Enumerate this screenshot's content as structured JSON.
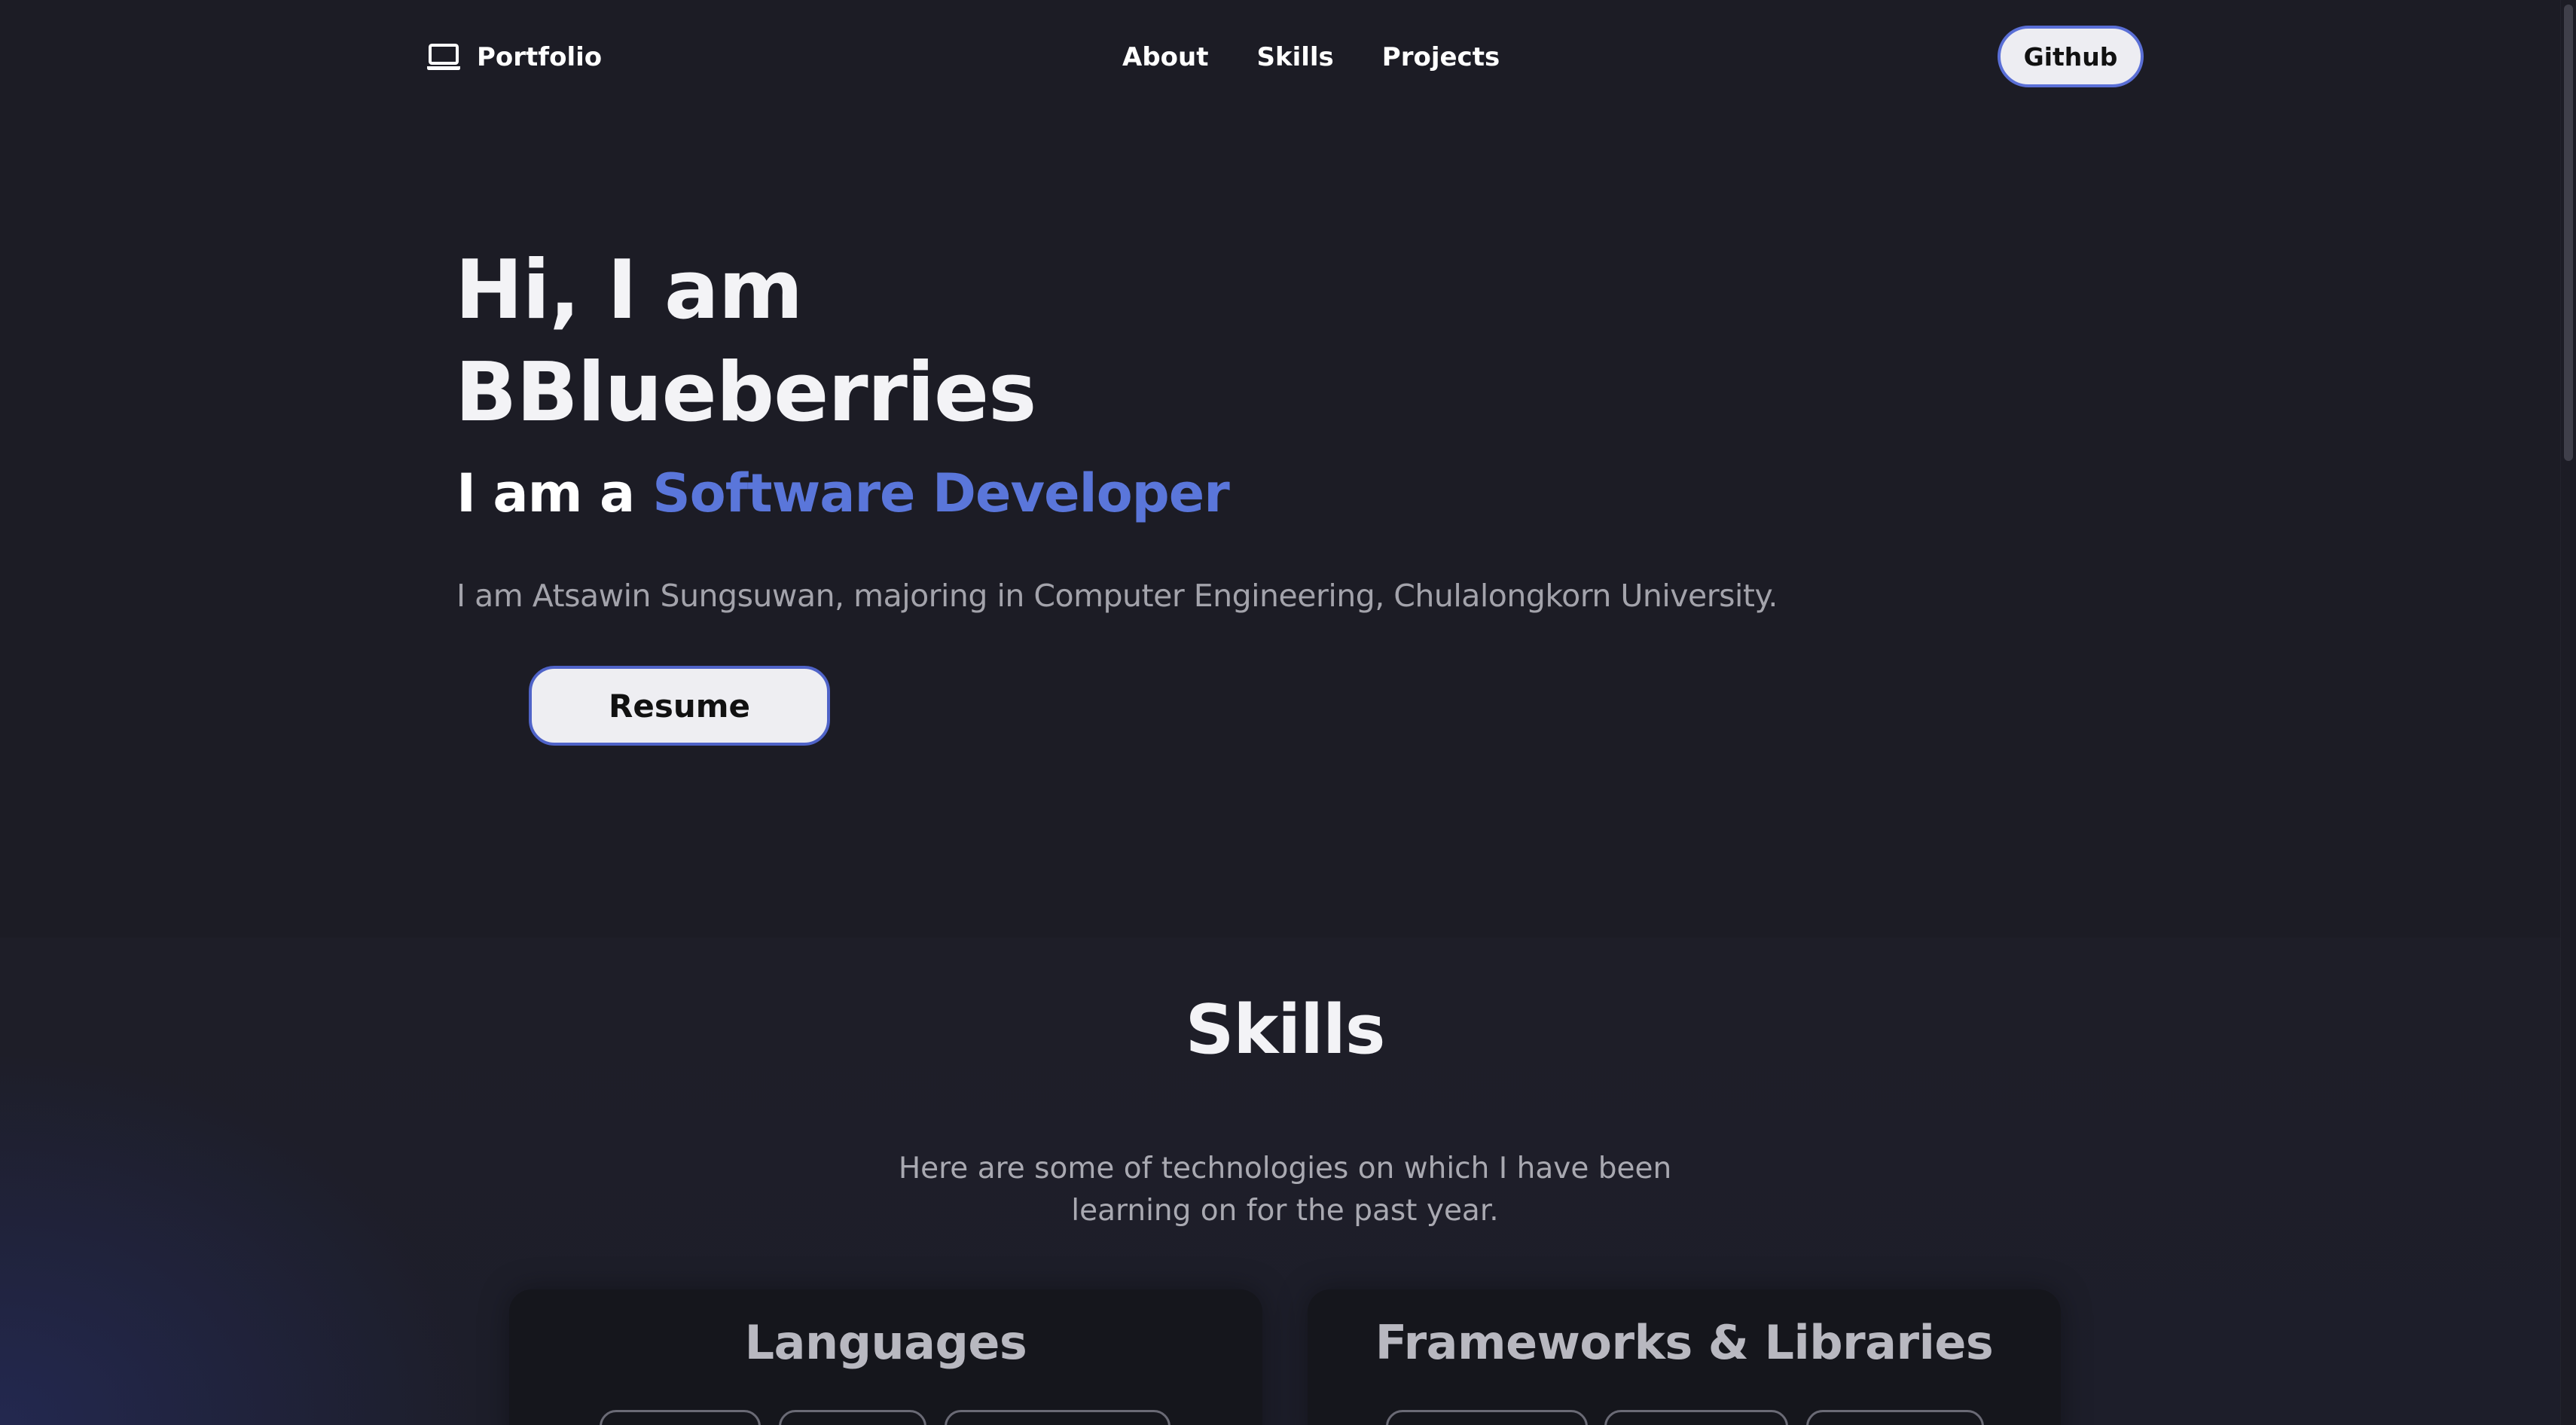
{
  "nav": {
    "brand": "Portfolio",
    "brand_icon": "laptop-icon",
    "links": [
      {
        "label": "About"
      },
      {
        "label": "Skills"
      },
      {
        "label": "Projects"
      }
    ],
    "github_label": "Github"
  },
  "hero": {
    "title_line1": "Hi, I am",
    "title_line2": "BBlueberries",
    "role_prefix": "I am a",
    "role": "Software Developer",
    "description": "I am Atsawin Sungsuwan, majoring in Computer Engineering, Chulalongkorn University.",
    "resume_label": "Resume"
  },
  "skills": {
    "title": "Skills",
    "description": "Here are some of technologies on which I have been learning on for the past year.",
    "cards": [
      {
        "title": "Languages"
      },
      {
        "title": "Frameworks & Libraries"
      }
    ]
  },
  "colors": {
    "accent": "#5a76da",
    "background": "#1c1c25",
    "button_bg": "#eeeef2"
  }
}
